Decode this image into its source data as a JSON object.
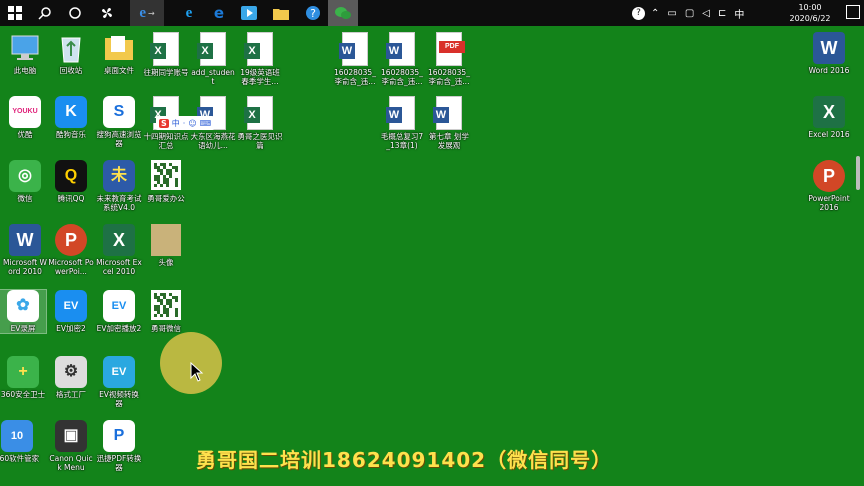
{
  "taskbar": {
    "items": [
      {
        "name": "start-button",
        "icon": "windows-icon",
        "color": "#ffffff"
      },
      {
        "name": "search-button",
        "icon": "search-icon",
        "color": "#ffffff"
      },
      {
        "name": "task-view-button",
        "icon": "circle-icon",
        "color": "#ffffff"
      },
      {
        "name": "fan-app",
        "icon": "fan-icon",
        "color": "#ffffff"
      },
      {
        "name": "ie-app",
        "icon": "ie-icon",
        "color": "#3a8ee6"
      },
      {
        "name": "edge-legacy",
        "icon": "ie-blue-icon",
        "color": "#1ea0f0"
      },
      {
        "name": "edge-app",
        "icon": "edge-icon",
        "color": "#1c7ad8"
      },
      {
        "name": "video-app",
        "icon": "play-icon",
        "color": "#3aa7e8"
      },
      {
        "name": "explorer-app",
        "icon": "folder-icon",
        "color": "#f2c94c"
      },
      {
        "name": "help-app",
        "icon": "help-icon",
        "color": "#2f8ee0"
      },
      {
        "name": "wechat-app",
        "icon": "wechat-icon",
        "color": "#3bb34a"
      }
    ],
    "tray": {
      "lang": "中",
      "time": "10:00",
      "date": "2020/6/22"
    }
  },
  "desktop": {
    "icons": [
      {
        "id": "pc",
        "label": "此电脑",
        "kind": "pc",
        "color": "#4aa3e8"
      },
      {
        "id": "recycle",
        "label": "回收站",
        "kind": "recycle",
        "color": "#cfe3ef"
      },
      {
        "id": "desktop-files",
        "label": "桌面文件",
        "kind": "folder",
        "color": "#f2c94c"
      },
      {
        "id": "x1",
        "label": "往期同学账号",
        "kind": "excel"
      },
      {
        "id": "x2",
        "label": "add_student",
        "kind": "excel"
      },
      {
        "id": "x3",
        "label": "19级英语班春季学生...",
        "kind": "excel"
      },
      {
        "id": "w1",
        "label": "16028035_李俞含_违...",
        "kind": "word"
      },
      {
        "id": "w2",
        "label": "16028035_李俞含_违...",
        "kind": "word"
      },
      {
        "id": "pdf1",
        "label": "16028035_李俞含_违...",
        "kind": "pdf"
      },
      {
        "id": "word2016",
        "label": "Word 2016",
        "kind": "word-app",
        "color": "#2b5797"
      },
      {
        "id": "youku",
        "label": "优酷",
        "kind": "app",
        "color": "#ffffff",
        "glyph": "YOUKU",
        "fg": "#e0227b"
      },
      {
        "id": "kugou",
        "label": "酷狗音乐",
        "kind": "app",
        "color": "#1a8ef0",
        "glyph": "K",
        "fg": "#ffffff"
      },
      {
        "id": "sogou",
        "label": "搜狗高速浏览器",
        "kind": "app",
        "color": "#ffffff",
        "glyph": "S",
        "fg": "#1a6fdc"
      },
      {
        "id": "x4",
        "label": "十四期知识点汇总",
        "kind": "excel"
      },
      {
        "id": "w3",
        "label": "大东区海燕花语幼儿...",
        "kind": "word"
      },
      {
        "id": "x5",
        "label": "勇哥之医见识篇",
        "kind": "excel"
      },
      {
        "id": "w4",
        "label": "毛概总复习7_13章(1)",
        "kind": "word"
      },
      {
        "id": "w5",
        "label": "第七章 划学发展观",
        "kind": "word"
      },
      {
        "id": "excel2016",
        "label": "Excel 2016",
        "kind": "excel-app",
        "color": "#1e7145"
      },
      {
        "id": "wechat",
        "label": "微信",
        "kind": "app",
        "color": "#3bb34a",
        "glyph": "◎",
        "fg": "#ffffff"
      },
      {
        "id": "qq",
        "label": "腾讯QQ",
        "kind": "app",
        "color": "#111111",
        "glyph": "Q",
        "fg": "#ffd000"
      },
      {
        "id": "exam",
        "label": "未来教育考试系统V4.0",
        "kind": "app",
        "color": "#2d5aa8",
        "glyph": "未",
        "fg": "#ffe14d"
      },
      {
        "id": "qr1",
        "label": "勇哥爱办公",
        "kind": "qr"
      },
      {
        "id": "ppt2016",
        "label": "PowerPoint 2016",
        "kind": "ppt-app",
        "color": "#d24726"
      },
      {
        "id": "word2010",
        "label": "Microsoft Word 2010",
        "kind": "word-app",
        "color": "#2b5797"
      },
      {
        "id": "ppt2010",
        "label": "Microsoft PowerPoi...",
        "kind": "ppt-app",
        "color": "#d24726"
      },
      {
        "id": "excel2010",
        "label": "Microsoft Excel 2010",
        "kind": "excel-app",
        "color": "#1e7145"
      },
      {
        "id": "avatar",
        "label": "头像",
        "kind": "photo",
        "color": "#c9b27a"
      },
      {
        "id": "evrec",
        "label": "EV录屏",
        "kind": "app",
        "color": "#ffffff",
        "glyph": "✿",
        "fg": "#3aa7e8"
      },
      {
        "id": "evenc",
        "label": "EV加密2",
        "kind": "app",
        "color": "#1a8ef0",
        "glyph": "EV",
        "fg": "#ffffff"
      },
      {
        "id": "evplay",
        "label": "EV加密播放2",
        "kind": "app",
        "color": "#ffffff",
        "glyph": "EV",
        "fg": "#1a8ef0"
      },
      {
        "id": "qr2",
        "label": "勇哥微信",
        "kind": "qr"
      },
      {
        "id": "360safe",
        "label": "360安全卫士",
        "kind": "app",
        "color": "#3bb34a",
        "glyph": "+",
        "fg": "#ffe14d"
      },
      {
        "id": "format",
        "label": "格式工厂",
        "kind": "app",
        "color": "#dddddd",
        "glyph": "⚙",
        "fg": "#333333"
      },
      {
        "id": "evconv",
        "label": "EV视频转换器",
        "kind": "app",
        "color": "#2aa8e0",
        "glyph": "EV",
        "fg": "#ffffff"
      },
      {
        "id": "360soft",
        "label": "360软件管家",
        "kind": "app",
        "color": "#3a8ee6",
        "glyph": "10",
        "fg": "#ffffff"
      },
      {
        "id": "canon",
        "label": "Canon Quick Menu",
        "kind": "app",
        "color": "#333333",
        "glyph": "▣",
        "fg": "#ffffff"
      },
      {
        "id": "pdfconv",
        "label": "迅捷PDF转换器",
        "kind": "app",
        "color": "#ffffff",
        "glyph": "P",
        "fg": "#1a6fdc"
      }
    ]
  },
  "ime": {
    "logo": "S",
    "items": [
      "中",
      "·",
      "☺",
      "⌨"
    ]
  },
  "caption": "勇哥国二培训18624091402（微信同号）"
}
